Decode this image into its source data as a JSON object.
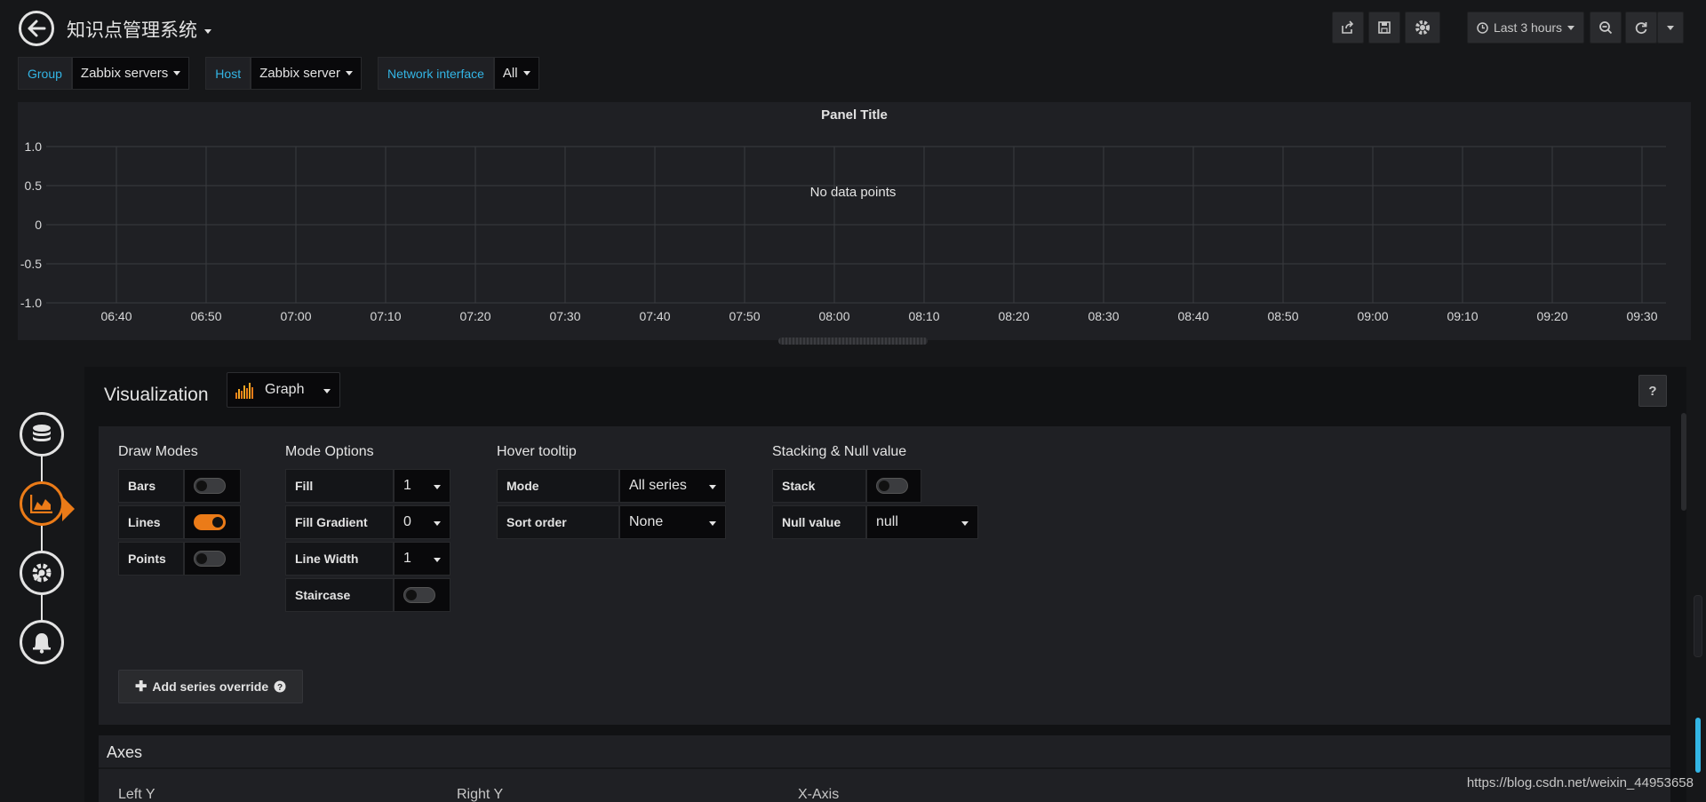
{
  "dashboard": {
    "title": "知识点管理系统"
  },
  "toolbar": {
    "time_range": "Last 3 hours"
  },
  "variables": [
    {
      "label": "Group",
      "value": "Zabbix servers"
    },
    {
      "label": "Host",
      "value": "Zabbix server"
    },
    {
      "label": "Network interface",
      "value": "All"
    }
  ],
  "panel": {
    "title": "Panel Title",
    "message": "No data points",
    "y_ticks": [
      "1.0",
      "0.5",
      "0",
      "-0.5",
      "-1.0"
    ],
    "x_ticks": [
      "06:40",
      "06:50",
      "07:00",
      "07:10",
      "07:20",
      "07:30",
      "07:40",
      "07:50",
      "08:00",
      "08:10",
      "08:20",
      "08:30",
      "08:40",
      "08:50",
      "09:00",
      "09:10",
      "09:20",
      "09:30"
    ]
  },
  "chart_data": {
    "type": "line",
    "title": "Panel Title",
    "series": [],
    "ylim": [
      -1.0,
      1.0
    ],
    "x": [
      "06:40",
      "06:50",
      "07:00",
      "07:10",
      "07:20",
      "07:30",
      "07:40",
      "07:50",
      "08:00",
      "08:10",
      "08:20",
      "08:30",
      "08:40",
      "08:50",
      "09:00",
      "09:10",
      "09:20",
      "09:30"
    ],
    "grid": true
  },
  "editor": {
    "visualization_label": "Visualization",
    "viz_type": "Graph",
    "help": "?",
    "draw_modes": {
      "title": "Draw Modes",
      "bars": "Bars",
      "lines": "Lines",
      "points": "Points",
      "bars_on": false,
      "lines_on": true,
      "points_on": false
    },
    "mode_options": {
      "title": "Mode Options",
      "fill_label": "Fill",
      "fill_value": "1",
      "fill_gradient_label": "Fill Gradient",
      "fill_gradient_value": "0",
      "line_width_label": "Line Width",
      "line_width_value": "1",
      "staircase_label": "Staircase",
      "staircase_on": false
    },
    "hover_tooltip": {
      "title": "Hover tooltip",
      "mode_label": "Mode",
      "mode_value": "All series",
      "sort_label": "Sort order",
      "sort_value": "None"
    },
    "stacking": {
      "title": "Stacking & Null value",
      "stack_label": "Stack",
      "stack_on": false,
      "null_label": "Null value",
      "null_value": "null"
    },
    "add_override": "Add series override",
    "axes": {
      "title": "Axes",
      "left_y": "Left Y",
      "right_y": "Right Y",
      "x_axis": "X-Axis"
    }
  },
  "watermark": "https://blog.csdn.net/weixin_44953658",
  "colors": {
    "accent": "#eb7b18",
    "label_blue": "#33b5e5",
    "grid": "#3a3b3f"
  }
}
